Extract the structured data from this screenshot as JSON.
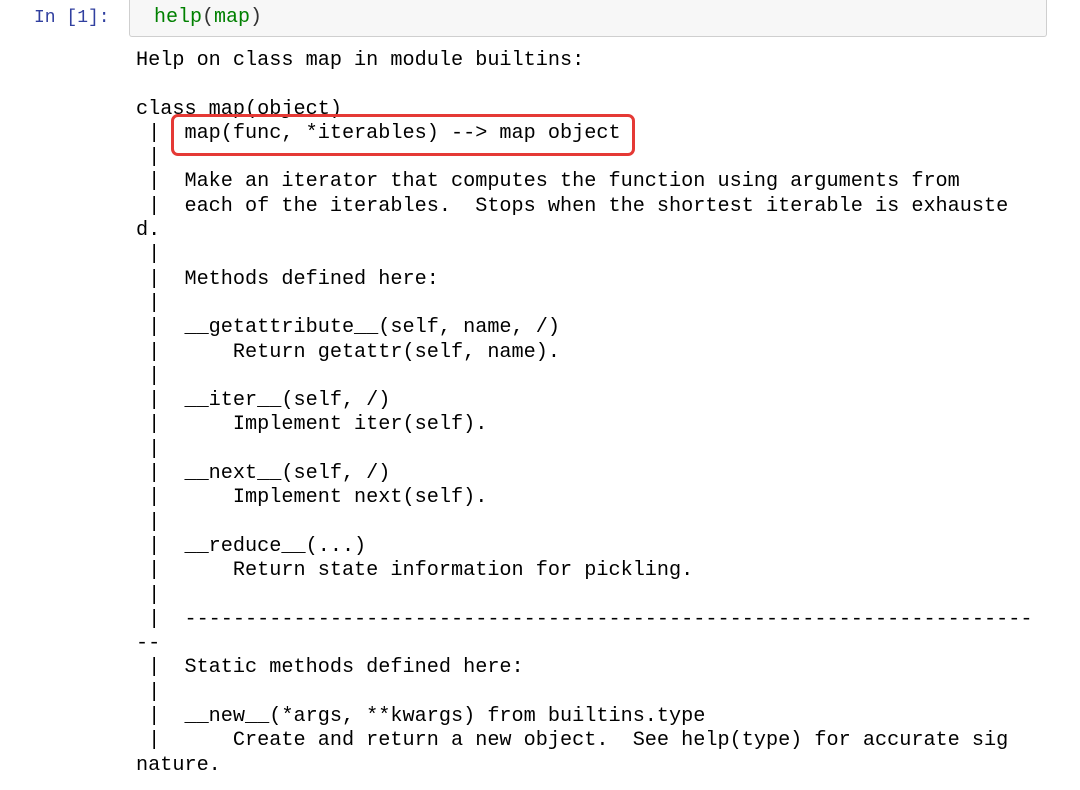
{
  "cell": {
    "prompt": "In [1]:",
    "input": {
      "func": "help",
      "open": "(",
      "arg": "map",
      "close": ")"
    },
    "output_lines": [
      "Help on class map in module builtins:",
      "",
      "class map(object)",
      " |  map(func, *iterables) --> map object",
      " |  ",
      " |  Make an iterator that computes the function using arguments from",
      " |  each of the iterables.  Stops when the shortest iterable is exhauste",
      "d.",
      " |  ",
      " |  Methods defined here:",
      " |  ",
      " |  __getattribute__(self, name, /)",
      " |      Return getattr(self, name).",
      " |  ",
      " |  __iter__(self, /)",
      " |      Implement iter(self).",
      " |  ",
      " |  __next__(self, /)",
      " |      Implement next(self).",
      " |  ",
      " |  __reduce__(...)",
      " |      Return state information for pickling.",
      " |  ",
      " |  ----------------------------------------------------------------------",
      "--",
      " |  Static methods defined here:",
      " |  ",
      " |  __new__(*args, **kwargs) from builtins.type",
      " |      Create and return a new object.  See help(type) for accurate sig",
      "nature."
    ]
  },
  "colors": {
    "prompt": "#303f9f",
    "builtin": "#008000",
    "highlight_border": "#e53935",
    "input_background": "#f7f7f7"
  }
}
